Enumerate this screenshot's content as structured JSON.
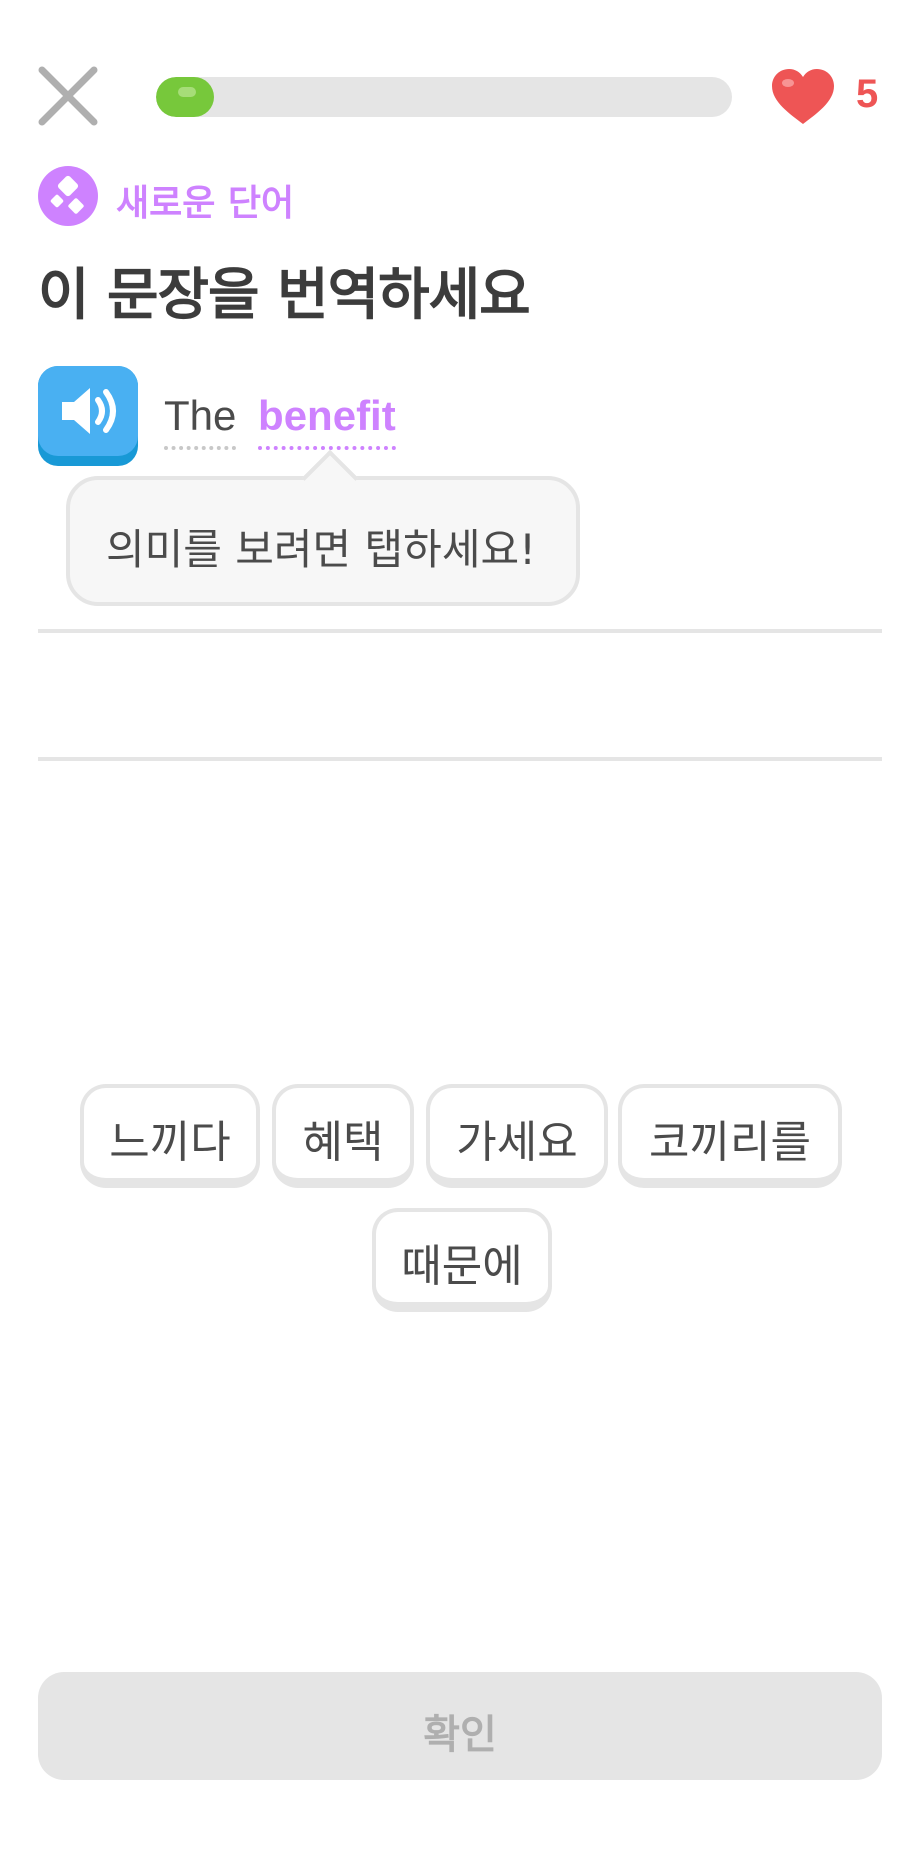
{
  "header": {
    "close_icon": "close-icon",
    "progress": 0.1,
    "progress_color": "#77c83b",
    "hearts_icon": "heart-icon",
    "hearts_count": "5",
    "hearts_color": "#ee5555"
  },
  "lesson": {
    "badge_icon": "new-word-icon",
    "badge_label": "새로운 단어",
    "badge_color": "#ce82ff",
    "instruction": "이 문장을 번역하세요",
    "speaker_icon": "speaker-icon",
    "sentence": {
      "words": [
        "The",
        "benefit"
      ],
      "highlighted_word": "benefit"
    },
    "tooltip": "의미를 보려면 탭하세요!"
  },
  "word_bank": {
    "tiles": [
      "느끼다",
      "혜택",
      "가세요",
      "코끼리를",
      "때문에"
    ]
  },
  "footer": {
    "check_label": "확인"
  }
}
